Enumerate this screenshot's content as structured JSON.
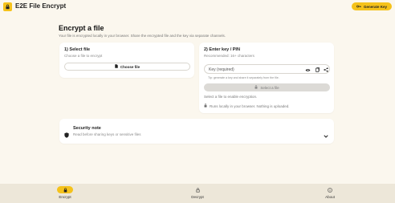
{
  "header": {
    "app_title": "E2E File Encrypt",
    "generate_key_label": "Generate Key"
  },
  "page": {
    "title": "Encrypt a file",
    "subtitle": "Your file is encrypted locally in your browser. Share the encrypted file and the key via separate channels."
  },
  "select_card": {
    "title": "1) Select file",
    "subtitle": "Choose a file to encrypt",
    "choose_label": "Choose file"
  },
  "key_card": {
    "title": "2) Enter key / PIN",
    "subtitle": "Recommended: 16+ characters",
    "key_placeholder": "Key (required)",
    "tip": "Tip: generate a key and share it separately from the file.",
    "select_file_label": "Select a file",
    "hint": "Select a file to enable encryption.",
    "local_note": "Runs locally in your browser. Nothing is uploaded."
  },
  "security_note": {
    "title": "Security note",
    "subtitle": "Read before sharing keys or sensitive files"
  },
  "bottom_nav": {
    "items": [
      {
        "label": "Encrypt",
        "icon": "lock-icon",
        "active": true
      },
      {
        "label": "Decrypt",
        "icon": "unlock-icon",
        "active": false
      },
      {
        "label": "About",
        "icon": "info-icon",
        "active": false
      }
    ]
  },
  "colors": {
    "accent": "#f5c21b",
    "background": "#fbf7ee",
    "nav_background": "#ede7d9"
  }
}
